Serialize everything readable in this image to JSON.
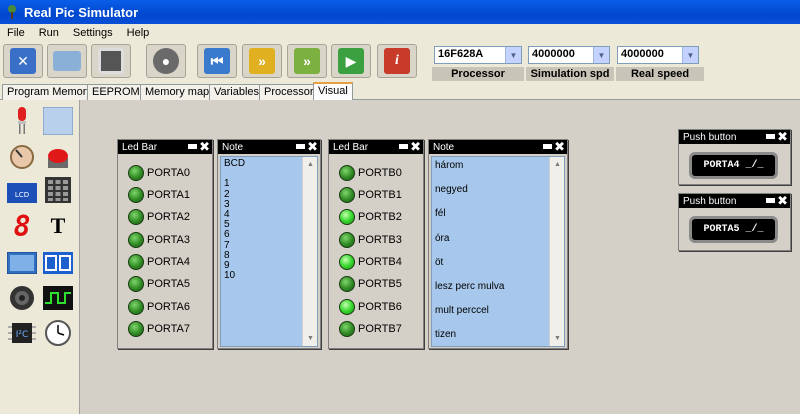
{
  "window": {
    "title": "Real Pic Simulator"
  },
  "menu": [
    "File",
    "Run",
    "Settings",
    "Help"
  ],
  "toolbar": {
    "buttons": [
      "close-project",
      "open",
      "save",
      "probe",
      "reset",
      "step",
      "step-over",
      "run",
      "about"
    ],
    "processor": {
      "value": "16F628A",
      "label": "Processor"
    },
    "sim_speed": {
      "value": "4000000",
      "label": "Simulation spd"
    },
    "real_speed": {
      "value": "4000000",
      "label": "Real speed"
    }
  },
  "tabs": [
    "Program Memory",
    "EEPROM",
    "Memory map",
    "Variables",
    "Processor",
    "Visual"
  ],
  "active_tab": "Visual",
  "palette": [
    "led-icon",
    "lcd-panel-icon",
    "potentiometer-icon",
    "red-button-icon",
    "lcd-display-icon",
    "keypad-icon",
    "seven-segment-icon",
    "text-icon",
    "graphic-lcd-icon",
    "dual-display-icon",
    "speaker-icon",
    "square-wave-icon",
    "chip-icon",
    "clock-icon"
  ],
  "ledbar_a": {
    "title": "Led Bar",
    "items": [
      {
        "label": "PORTA0",
        "on": false
      },
      {
        "label": "PORTA1",
        "on": false
      },
      {
        "label": "PORTA2",
        "on": false
      },
      {
        "label": "PORTA3",
        "on": false
      },
      {
        "label": "PORTA4",
        "on": false
      },
      {
        "label": "PORTA5",
        "on": false
      },
      {
        "label": "PORTA6",
        "on": false
      },
      {
        "label": "PORTA7",
        "on": false
      }
    ]
  },
  "note_a": {
    "title": "Note",
    "text": "BCD\n\n1\n2\n3\n4\n5\n6\n7\n8\n9\n10"
  },
  "ledbar_b": {
    "title": "Led Bar",
    "items": [
      {
        "label": "PORTB0",
        "on": false
      },
      {
        "label": "PORTB1",
        "on": false
      },
      {
        "label": "PORTB2",
        "on": true
      },
      {
        "label": "PORTB3",
        "on": false
      },
      {
        "label": "PORTB4",
        "on": true
      },
      {
        "label": "PORTB5",
        "on": false
      },
      {
        "label": "PORTB6",
        "on": true
      },
      {
        "label": "PORTB7",
        "on": false
      }
    ]
  },
  "note_b": {
    "title": "Note",
    "lines": [
      "három",
      "negyed",
      "fél",
      "óra",
      "öt",
      "lesz perc mulva",
      "mult perccel",
      "tizen"
    ]
  },
  "push_a": {
    "title": "Push button",
    "label": "PORTA4 _/_"
  },
  "push_b": {
    "title": "Push button",
    "label": "PORTA5 _/_"
  }
}
